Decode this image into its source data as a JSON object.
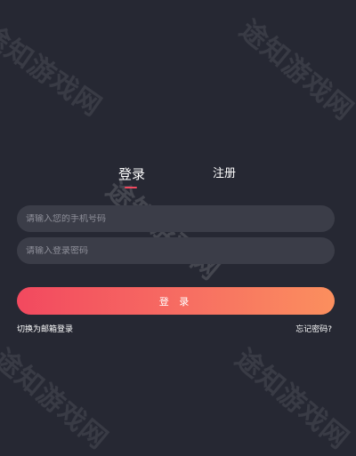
{
  "watermark": "途知游戏网",
  "tabs": {
    "login": "登录",
    "register": "注册"
  },
  "form": {
    "phone_placeholder": "请输入您的手机号码",
    "password_placeholder": "请输入登录密码"
  },
  "buttons": {
    "login": "登 录"
  },
  "links": {
    "switch_email": "切换为邮箱登录",
    "forgot_password": "忘记密码?"
  },
  "colors": {
    "background": "#262833",
    "field": "#3b3d48",
    "accent": "#f2495f",
    "gradient_end": "#fb8f5e"
  }
}
